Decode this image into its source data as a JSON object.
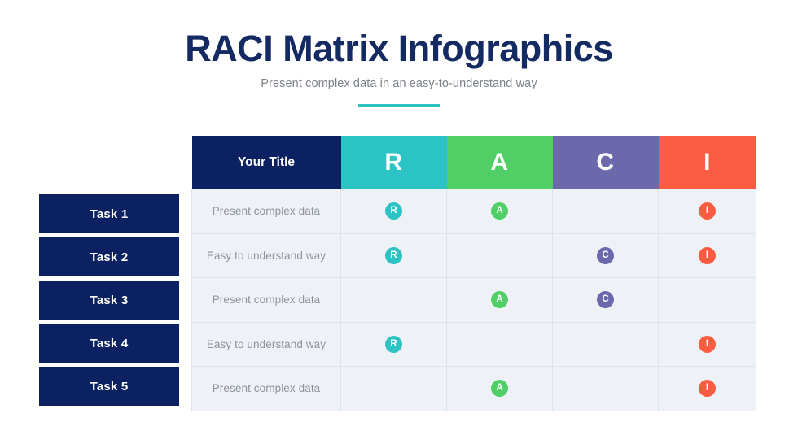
{
  "header": {
    "title": "RACI Matrix Infographics",
    "subtitle": "Present complex data in an easy-to-understand way",
    "accent_color": "#2cc3c5"
  },
  "colors": {
    "navy": "#0b2161",
    "responsible": "#2cc3c5",
    "accountable": "#50cf67",
    "consulted": "#6b68ab",
    "informed": "#fa5c42",
    "cell_bg": "#eef2f7",
    "grid_line": "#dbe3ec",
    "desc_text": "#8d939c"
  },
  "table": {
    "columns": [
      {
        "key": "title",
        "label": "Your Title",
        "bg": "#0b2161"
      },
      {
        "key": "R",
        "label": "R",
        "bg": "#2cc3c5"
      },
      {
        "key": "A",
        "label": "A",
        "bg": "#50cf67"
      },
      {
        "key": "C",
        "label": "C",
        "bg": "#6b68ab"
      },
      {
        "key": "I",
        "label": "I",
        "bg": "#fa5c42"
      }
    ],
    "rows": [
      {
        "task": "Task 1",
        "description": "Present complex data",
        "R": "R",
        "A": "A",
        "C": "",
        "I": "I"
      },
      {
        "task": "Task 2",
        "description": "Easy to understand way",
        "R": "R",
        "A": "",
        "C": "C",
        "I": "I"
      },
      {
        "task": "Task 3",
        "description": "Present complex data",
        "R": "",
        "A": "A",
        "C": "C",
        "I": ""
      },
      {
        "task": "Task 4",
        "description": "Easy to understand way",
        "R": "R",
        "A": "",
        "C": "",
        "I": "I"
      },
      {
        "task": "Task 5",
        "description": "Present complex data",
        "R": "",
        "A": "A",
        "C": "",
        "I": "I"
      }
    ]
  }
}
